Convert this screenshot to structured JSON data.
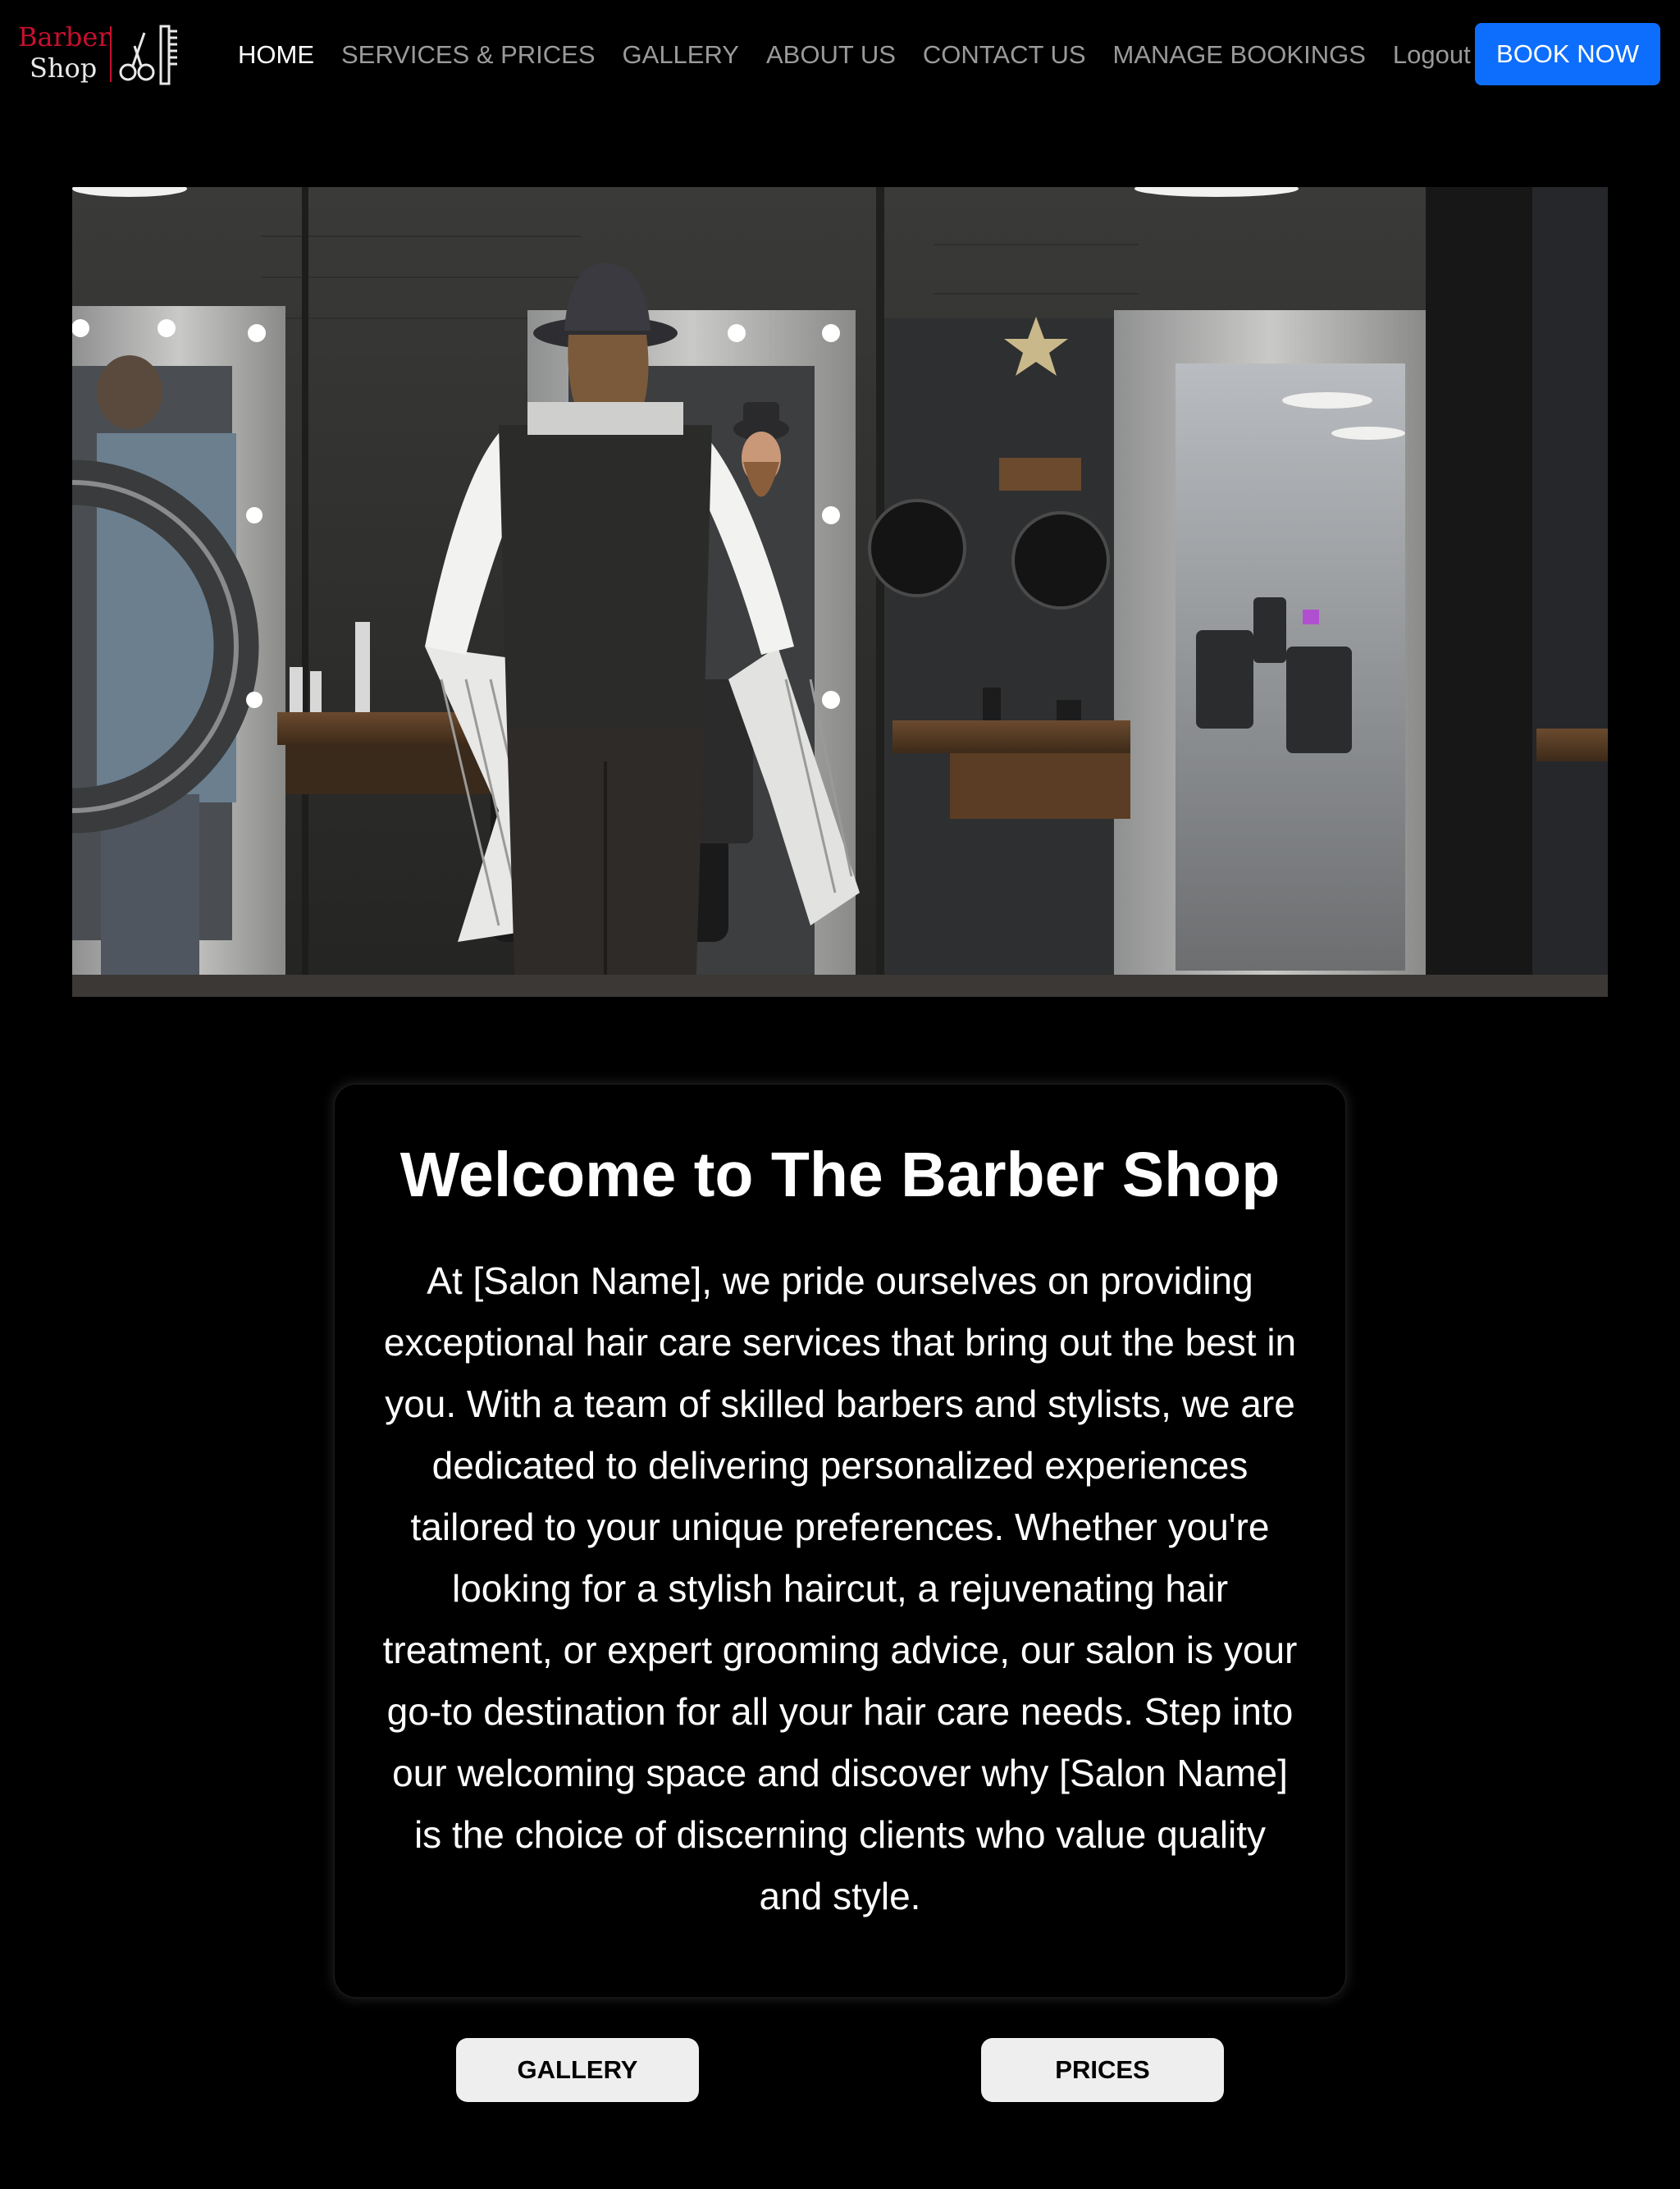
{
  "brand": {
    "line1": "Barber",
    "line2": "Shop",
    "accent_color": "#c8102e"
  },
  "nav": {
    "items": [
      {
        "label": "HOME",
        "active": true
      },
      {
        "label": "SERVICES & PRICES",
        "active": false
      },
      {
        "label": "GALLERY",
        "active": false
      },
      {
        "label": "ABOUT US",
        "active": false
      },
      {
        "label": "CONTACT US",
        "active": false
      },
      {
        "label": "MANAGE BOOKINGS",
        "active": false
      },
      {
        "label": "Logout",
        "active": false
      }
    ],
    "book_button": "BOOK NOW",
    "book_button_color": "#0d6efd"
  },
  "hero": {
    "image_icon": "barbershop-photo"
  },
  "welcome": {
    "title": "Welcome to The Barber Shop",
    "body": "At [Salon Name], we pride ourselves on providing exceptional hair care services that bring out the best in you. With a team of skilled barbers and stylists, we are dedicated to delivering personalized experiences tailored to your unique preferences. Whether you're looking for a stylish haircut, a rejuvenating hair treatment, or expert grooming advice, our salon is your go-to destination for all your hair care needs. Step into our welcoming space and discover why [Salon Name] is the choice of discerning clients who value quality and style."
  },
  "cta": {
    "gallery_label": "GALLERY",
    "prices_label": "PRICES"
  }
}
